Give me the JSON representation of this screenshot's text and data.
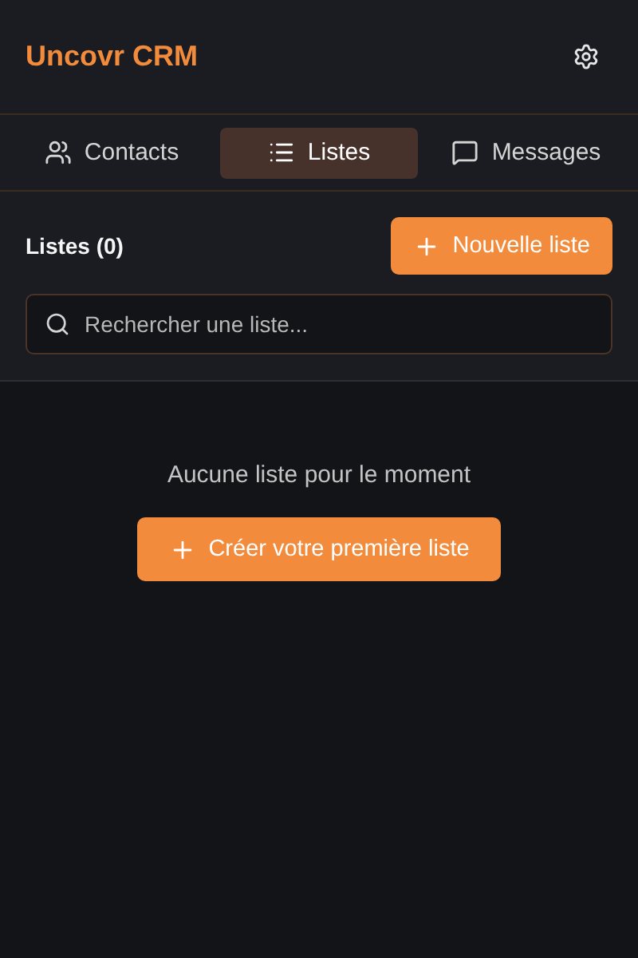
{
  "header": {
    "title": "Uncovr CRM"
  },
  "tabs": [
    {
      "label": "Contacts",
      "kind": "people",
      "selected": false
    },
    {
      "label": "Listes",
      "kind": "list",
      "selected": true
    },
    {
      "label": "Messages",
      "kind": "chat",
      "selected": false
    }
  ],
  "toolbar": {
    "heading": "Listes (0)",
    "button": "Nouvelle liste"
  },
  "search": {
    "placeholder": "Rechercher une liste..."
  },
  "empty_state": {
    "message": "Aucune liste pour le moment",
    "button": "Créer votre première liste"
  }
}
